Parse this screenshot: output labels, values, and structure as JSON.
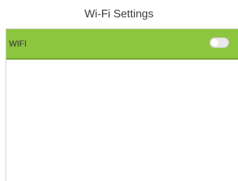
{
  "header": {
    "title": "Wi-Fi Settings"
  },
  "settings": {
    "items": [
      {
        "label": "WIFI",
        "enabled": false
      }
    ]
  },
  "colors": {
    "row_background": "#8cc63f",
    "toggle_off": "#e9e9e9"
  },
  "icons": {
    "toggle": "toggle-switch-icon"
  }
}
